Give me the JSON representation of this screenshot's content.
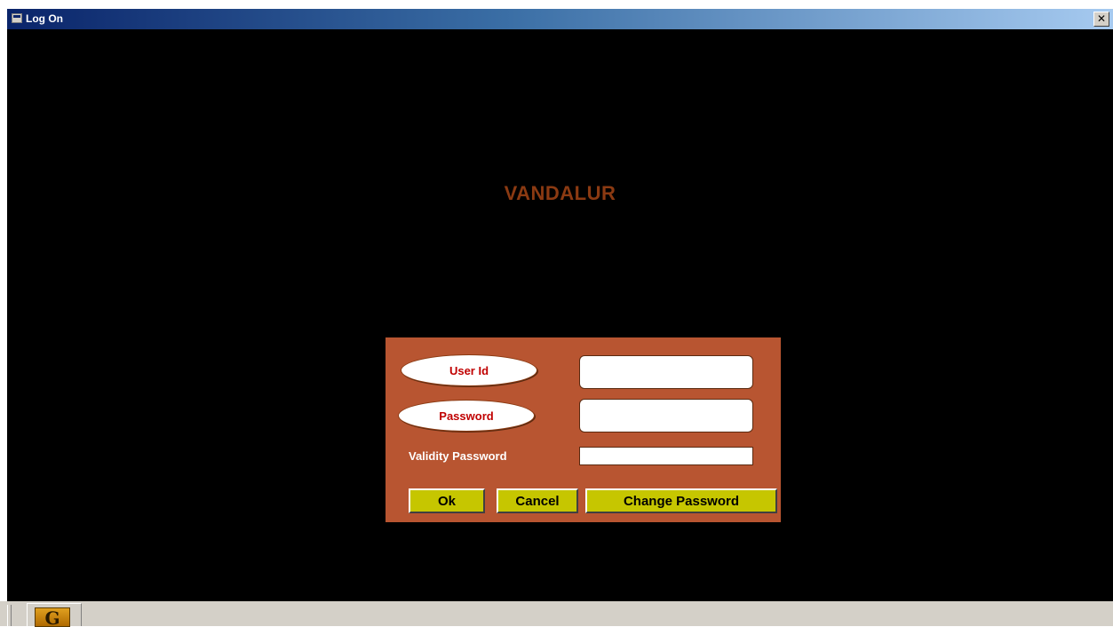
{
  "window": {
    "title": "Log On",
    "close_glyph": "✕",
    "icon": "form-window-icon"
  },
  "app_title": "VANDALUR",
  "form": {
    "user_id_label": "User Id",
    "user_id_value": "",
    "password_label": "Password",
    "password_value": "",
    "validity_password_label": "Validity Password",
    "validity_password_value": "",
    "buttons": {
      "ok": "Ok",
      "cancel": "Cancel",
      "change_password": "Change Password"
    }
  },
  "taskbar": {
    "app_icon": "company-logo-icon",
    "logo_letter": "G"
  },
  "colors": {
    "background": "#000000",
    "panel": "#b85531",
    "button": "#c6c600",
    "label_red": "#c00000",
    "title_brown": "#8b3a12"
  }
}
